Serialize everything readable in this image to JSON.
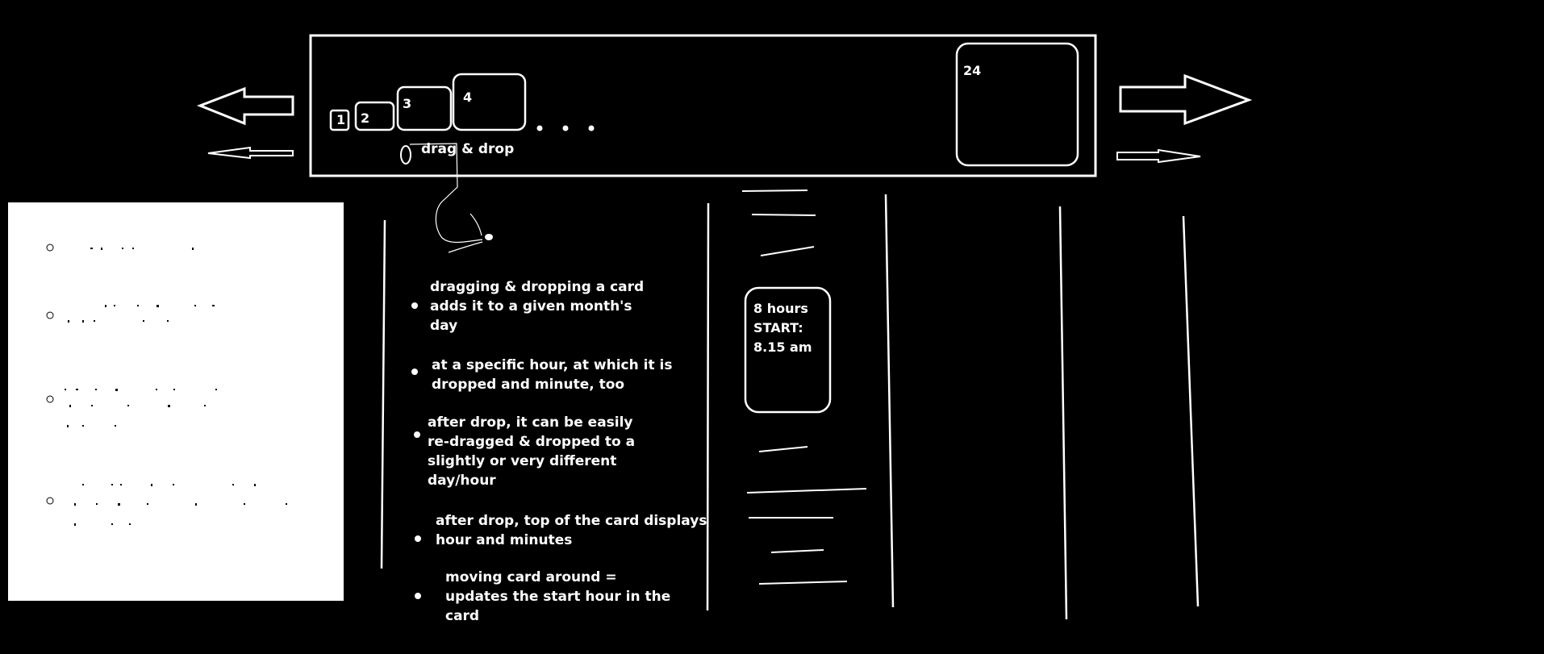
{
  "card_strip": {
    "cards": [
      "1",
      "2",
      "3",
      "4",
      "24"
    ],
    "ellipsis": "• • •",
    "drag_label": "drag & drop"
  },
  "bullets": [
    "dragging & dropping a card\nadds it to a given month's\nday",
    "at a specific hour, at which it is\ndropped  and minute, too",
    "after drop, it can be easily\nre-dragged & dropped to a\nslightly or very different\nday/hour",
    "after drop, top of the card displays\nhour and minutes",
    "moving card around =\nupdates the start hour in the\ncard"
  ],
  "event_card": {
    "text": "8 hours\nSTART:\n8.15 am"
  },
  "colors": {
    "background": "#000000",
    "foreground": "#ffffff"
  }
}
